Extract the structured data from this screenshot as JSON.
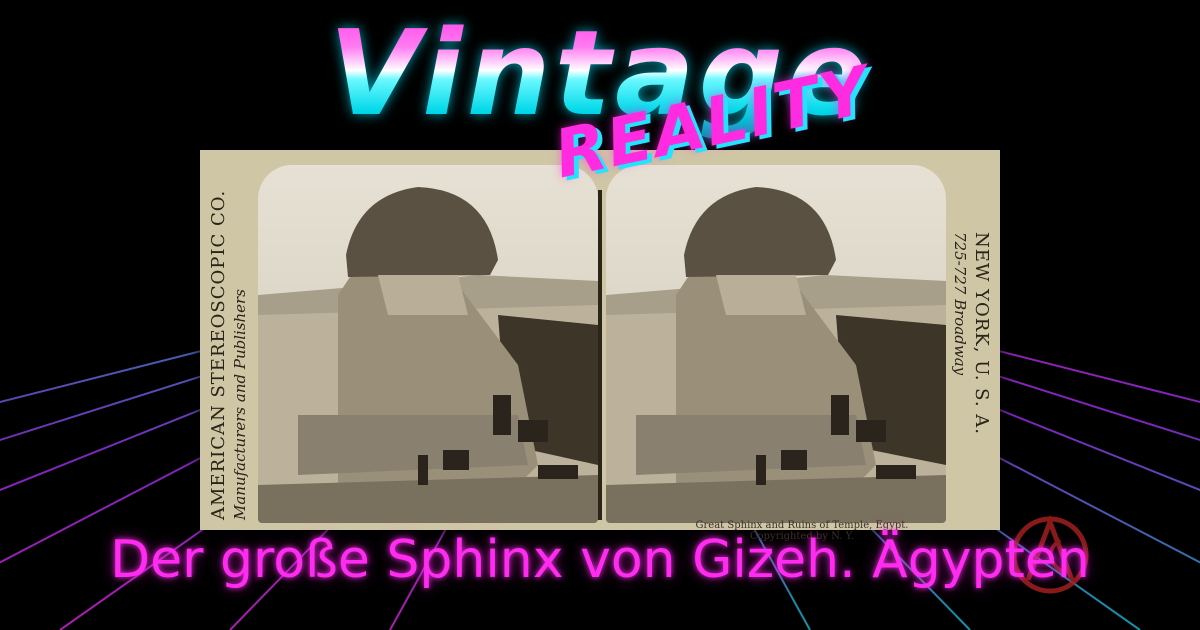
{
  "header": {
    "title": "Vintage",
    "subtitle": "REALITY"
  },
  "card": {
    "left_margin_line1": "AMERICAN STEREOSCOPIC CO.",
    "left_margin_line2": "Manufacturers and Publishers",
    "right_margin_line1": "NEW YORK, U. S. A.",
    "right_margin_line2": "725-727 Broadway",
    "caption_line1": "Great Sphinx and Ruins of Temple, Egypt.",
    "caption_line2": "Copyrighted by N. Y."
  },
  "footer": {
    "title": "Der große Sphinx von Gizeh. Ägypten"
  },
  "colors": {
    "neon_pink": "#ff2bf0",
    "neon_cyan": "#22e4ff",
    "grid_pink": "#c020c0",
    "grid_cyan": "#10a8b8",
    "card": "#cfc6a6"
  },
  "logo": {
    "icon": "retro-circle-monogram-icon"
  }
}
